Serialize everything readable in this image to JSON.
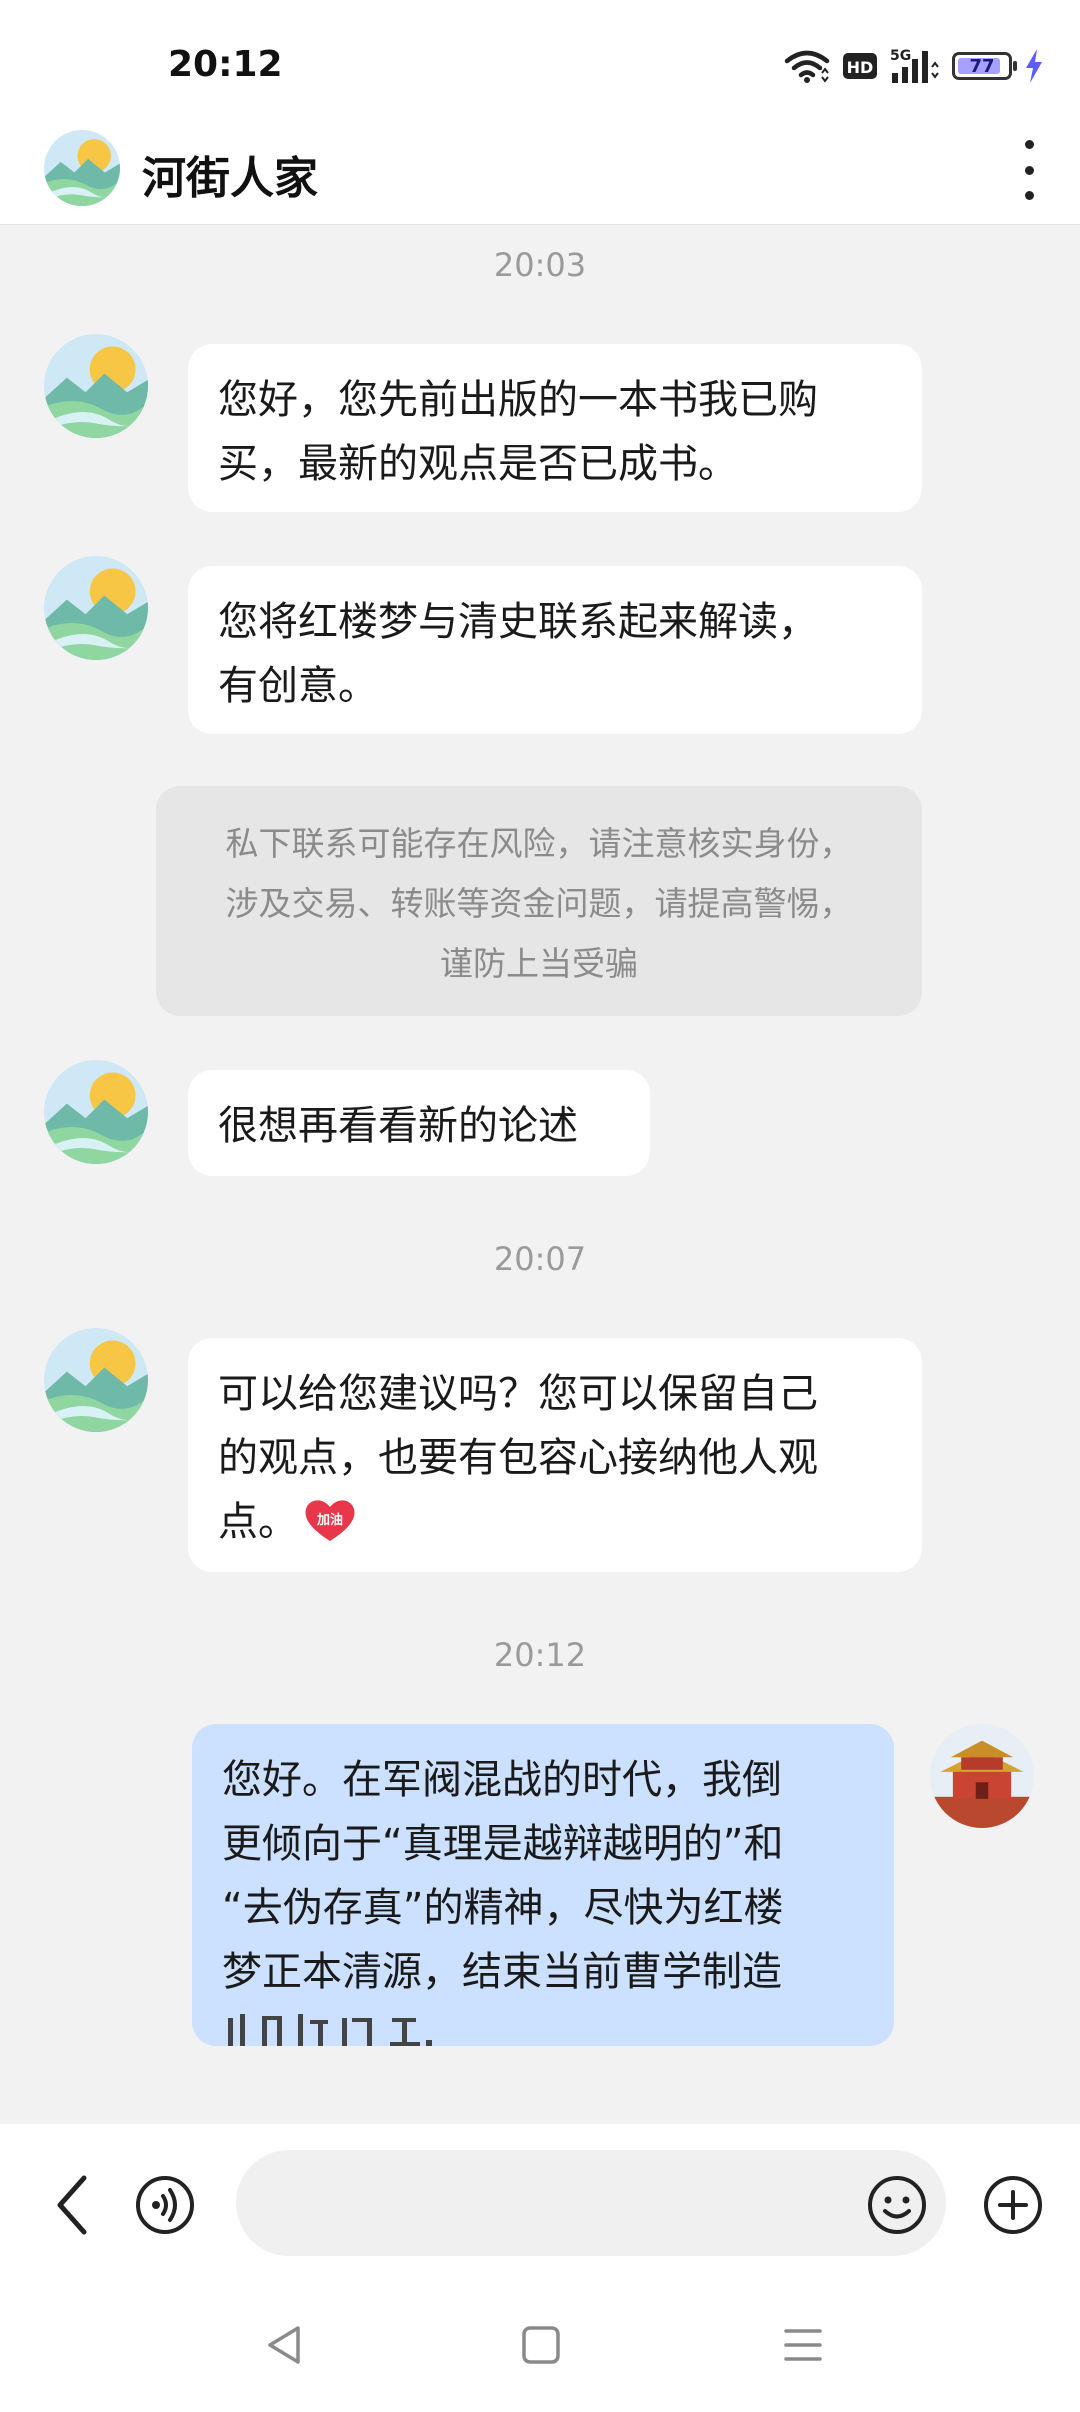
{
  "status_bar": {
    "time": "20:12",
    "icons": [
      "wifi-icon",
      "hd-icon",
      "5g-signal-icon",
      "battery-icon",
      "charging-icon"
    ],
    "hd_label": "HD",
    "network_label": "5G",
    "battery_level": "77"
  },
  "header": {
    "title": "河街人家",
    "more_icon": "more-vertical-icon"
  },
  "chat": {
    "timestamps": [
      "20:03",
      "20:07",
      "20:12"
    ],
    "messages": [
      {
        "from": "contact",
        "text_lines": [
          "您好，您先前出版的一本书我已购",
          "买，最新的观点是否已成书。"
        ]
      },
      {
        "from": "contact",
        "text_lines": [
          "您将红楼梦与清史联系起来解读，",
          "有创意。"
        ]
      },
      {
        "from": "contact",
        "text_lines": [
          "很想再看看新的论述"
        ]
      },
      {
        "from": "contact",
        "text_lines": [
          "可以给您建议吗？您可以保留自己",
          "的观点，也要有包容心接纳他人观",
          "点。"
        ],
        "sticker_text": "加油"
      },
      {
        "from": "me",
        "text_lines": [
          "您好。在军阀混战的时代，我倒",
          "更倾向于“真理是越辩越明的”和",
          "“去伪存真”的精神，尽快为红楼",
          "梦正本清源，结束当前曹学制造"
        ]
      }
    ],
    "notice_lines": [
      "私下联系可能存在风险，请注意核实身份，",
      "涉及交易、转账等资金问题，请提高警惕，",
      "谨防上当受骗"
    ]
  },
  "input_bar": {
    "value": "",
    "icons": [
      "back-icon",
      "voice-icon",
      "emoji-icon",
      "plus-icon"
    ]
  },
  "nav_bar": {
    "icons": [
      "nav-back-icon",
      "nav-home-icon",
      "nav-menu-icon"
    ]
  },
  "colors": {
    "chat_background": "#f2f2f2",
    "my_bubble": "#cce0ff",
    "contact_bubble": "#ffffff",
    "notice_background": "#e6e6e6",
    "battery_fill": "#a7a0ff",
    "charging": "#5b5bff"
  }
}
